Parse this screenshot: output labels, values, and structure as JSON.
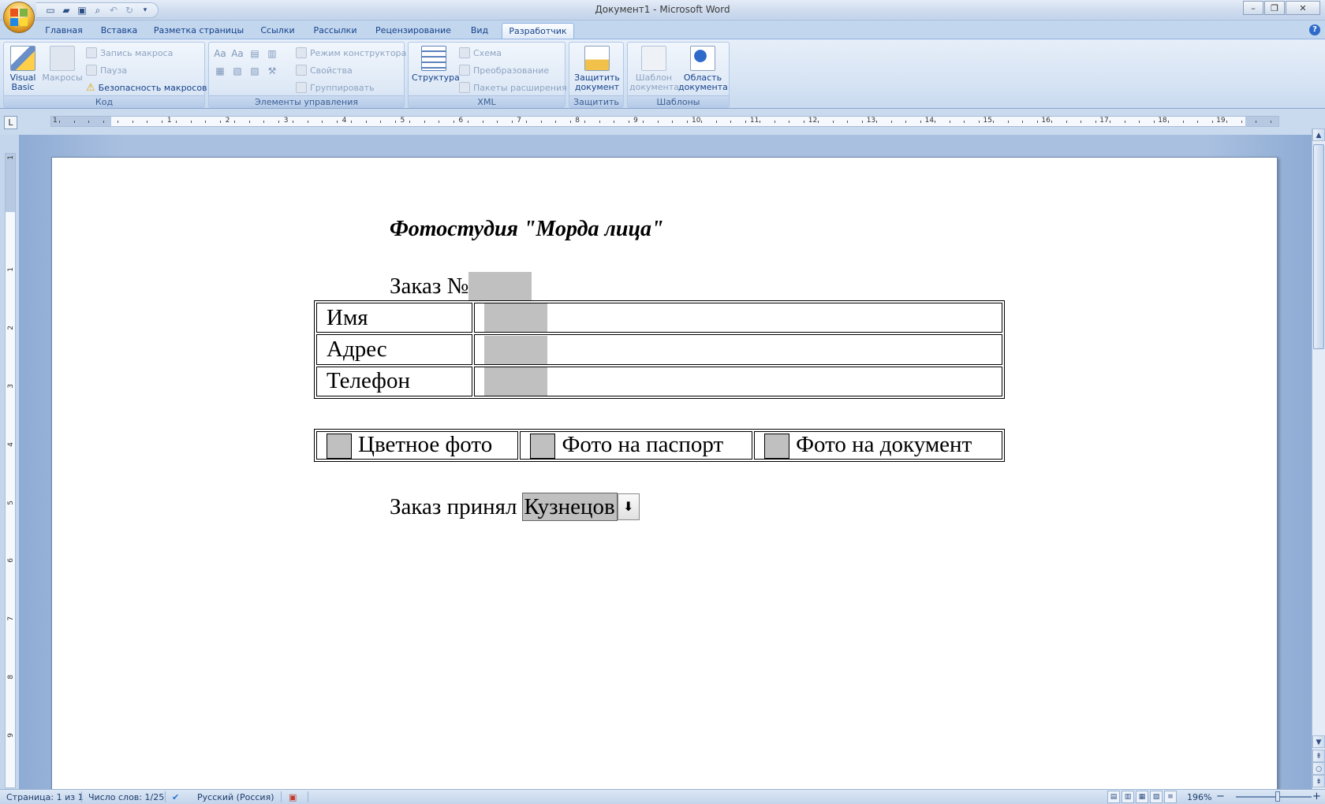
{
  "window": {
    "title": "Документ1 - Microsoft Word",
    "minimize": "–",
    "maximize": "❐",
    "close": "✕"
  },
  "quick_access": [
    "save-icon",
    "undo-icon",
    "redo-icon"
  ],
  "tabs": [
    {
      "label": "Главная"
    },
    {
      "label": "Вставка"
    },
    {
      "label": "Разметка страницы"
    },
    {
      "label": "Ссылки"
    },
    {
      "label": "Рассылки"
    },
    {
      "label": "Рецензирование"
    },
    {
      "label": "Вид"
    },
    {
      "label": "Разработчик",
      "active": true
    }
  ],
  "ribbon": {
    "code": {
      "label": "Код",
      "visual_basic": "Visual Basic",
      "visual_basic_1": "Visual",
      "visual_basic_2": "Basic",
      "macros": "Макросы",
      "record_macro": "Запись макроса",
      "pause": "Пауза",
      "macro_security": "Безопасность макросов"
    },
    "controls": {
      "label": "Элементы управления",
      "design_mode": "Режим конструктора",
      "properties": "Свойства",
      "group": "Группировать"
    },
    "xml": {
      "label": "XML",
      "structure": "Структура",
      "schema": "Схема",
      "transform": "Преобразование",
      "expansion_packs": "Пакеты расширения"
    },
    "protect": {
      "label": "Защитить",
      "protect_doc_1": "Защитить",
      "protect_doc_2": "документ"
    },
    "templates": {
      "label": "Шаблоны",
      "doc_template_1": "Шаблон",
      "doc_template_2": "документа",
      "doc_panel_1": "Область",
      "doc_panel_2": "документа"
    }
  },
  "ruler": {
    "h_numbers": [
      "1",
      "1",
      "2",
      "3",
      "4",
      "5",
      "6",
      "7",
      "8",
      "9",
      "10",
      "11",
      "12",
      "13",
      "14",
      "15",
      "16",
      "17",
      "18",
      "19"
    ],
    "v_numbers": [
      "1",
      "1",
      "2",
      "3",
      "4",
      "5",
      "6",
      "7",
      "8",
      "9"
    ]
  },
  "document": {
    "title": "Фотостудия \"Морда лица\"",
    "order_label": "Заказ №",
    "info_rows": [
      {
        "label": "Имя"
      },
      {
        "label": "Адрес"
      },
      {
        "label": "Телефон"
      }
    ],
    "checkboxes": [
      {
        "label": "Цветное фото"
      },
      {
        "label": "Фото на паспорт"
      },
      {
        "label": "Фото на документ"
      }
    ],
    "accepted_label": "Заказ принял",
    "accepted_value": "Кузнецов"
  },
  "status": {
    "page": "Страница: 1 из 1",
    "words": "Число слов: 1/25",
    "language": "Русский (Россия)",
    "zoom": "196%",
    "zoom_minus": "−",
    "zoom_plus": "+"
  }
}
